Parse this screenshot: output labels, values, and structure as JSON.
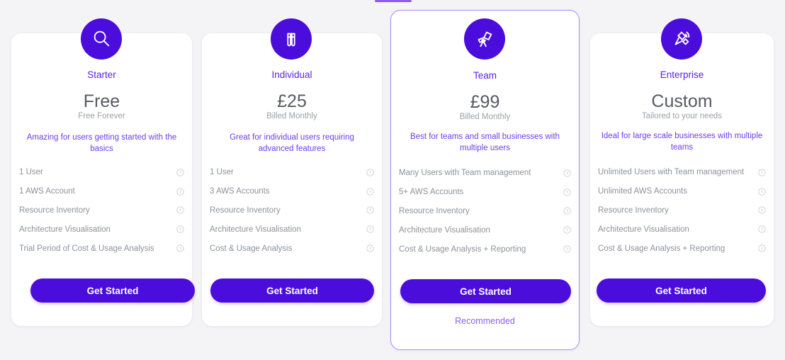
{
  "theme": {
    "page_background": "#f4f4f6",
    "card_background": "#ffffff",
    "brand_purple": "#4b0ddb",
    "accent_purple": "#5b21ee",
    "highlight_border": "#a78bfa",
    "tab_indicator": "#8b5cf6",
    "muted_text": "#8d9299",
    "price_text": "#555b63"
  },
  "tab_indicator": {
    "name": "active-tab-underline"
  },
  "help_icon_name": "help-circle-icon",
  "plans": [
    {
      "id": "starter",
      "icon": "magnifier-icon",
      "name": "Starter",
      "price": "Free",
      "price_sub": "Free Forever",
      "tagline": "Amazing for users getting started with the basics",
      "features": [
        "1 User",
        "1 AWS Account",
        "Resource Inventory",
        "Architecture Visualisation",
        "Trial Period of Cost & Usage Analysis"
      ],
      "cta_label": "Get Started",
      "recommended_label": "",
      "highlighted": false
    },
    {
      "id": "individual",
      "icon": "binoculars-icon",
      "name": "Individual",
      "price": "£25",
      "price_sub": "Billed Monthly",
      "tagline": "Great for individual users requiring advanced features",
      "features": [
        "1 User",
        "3 AWS Accounts",
        "Resource Inventory",
        "Architecture Visualisation",
        "Cost & Usage Analysis"
      ],
      "cta_label": "Get Started",
      "recommended_label": "",
      "highlighted": false
    },
    {
      "id": "team",
      "icon": "telescope-icon",
      "name": "Team",
      "price": "£99",
      "price_sub": "Billed Monthly",
      "tagline": "Best for teams and small businesses with multiple users",
      "features": [
        "Many Users with Team management",
        "5+ AWS Accounts",
        "Resource Inventory",
        "Architecture Visualisation",
        "Cost & Usage Analysis + Reporting"
      ],
      "cta_label": "Get Started",
      "recommended_label": "Recommended",
      "highlighted": true
    },
    {
      "id": "enterprise",
      "icon": "satellite-icon",
      "name": "Enterprise",
      "price": "Custom",
      "price_sub": "Tailored to your needs",
      "tagline": "Ideal for large scale businesses with multiple teams",
      "features": [
        "Unlimited Users with Team management",
        "Unlimited AWS Accounts",
        "Resource Inventory",
        "Architecture Visualisation",
        "Cost & Usage Analysis + Reporting"
      ],
      "cta_label": "Get Started",
      "recommended_label": "",
      "highlighted": false
    }
  ]
}
